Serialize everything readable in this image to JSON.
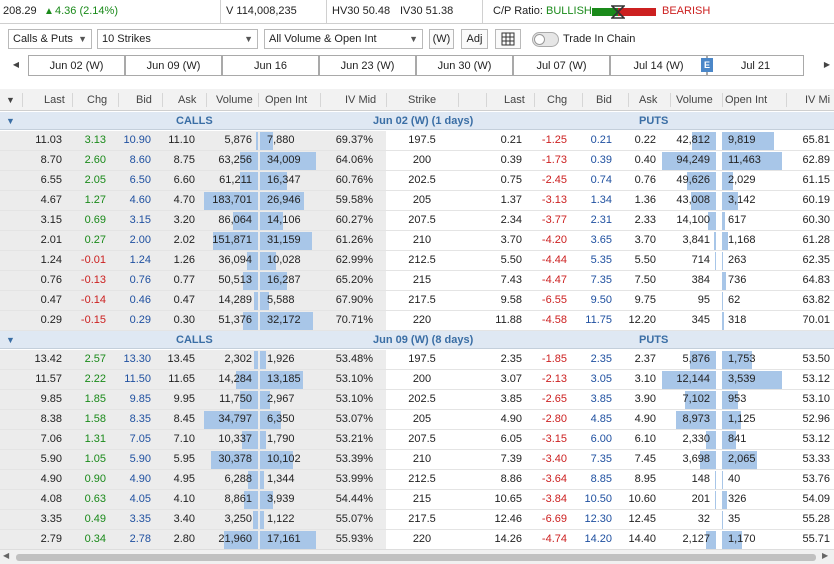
{
  "topbar": {
    "price": "208.29",
    "change": "4.36 (2.14%)",
    "volume": "V 114,008,235",
    "hv30": "HV30 50.48",
    "iv30": "IV30 51.38",
    "cp_ratio_label": "C/P Ratio:",
    "bullish": "BULLISH",
    "bearish": "BEARISH"
  },
  "controls": {
    "type_select": "Calls & Puts",
    "strikes_select": "10 Strikes",
    "volume_select": "All Volume & Open Int",
    "weekly_button": "(W)",
    "adj_button": "Adj",
    "trade_in_chain": "Trade In Chain"
  },
  "dates": [
    "Jun 02 (W)",
    "Jun 09 (W)",
    "Jun 16",
    "Jun 23 (W)",
    "Jun 30 (W)",
    "Jul 07 (W)",
    "Jul 14 (W)",
    "Jul 21"
  ],
  "earnings_marker": "E",
  "columns": {
    "call": [
      "Last",
      "Chg",
      "Bid",
      "Ask",
      "Volume",
      "Open Int",
      "IV Mid"
    ],
    "strike": "Strike",
    "put": [
      "Last",
      "Chg",
      "Bid",
      "Ask",
      "Volume",
      "Open Int",
      "IV Mi"
    ]
  },
  "sections": [
    {
      "calls_label": "CALLS",
      "expiry_label": "Jun 02 (W) (1 days)",
      "puts_label": "PUTS",
      "rows": [
        {
          "c": [
            "11.03",
            "3.13",
            "10.90",
            "11.10",
            "5,876",
            "7,880",
            "69.37%"
          ],
          "cvol": 0.03,
          "coi": 0.23,
          "strike": "197.5",
          "p": [
            "0.21",
            "-1.25",
            "0.21",
            "0.22",
            "42,812",
            "9,819",
            "65.81"
          ],
          "pvol": 0.45,
          "poi": 0.86
        },
        {
          "c": [
            "8.70",
            "2.60",
            "8.60",
            "8.75",
            "63,256",
            "34,009",
            "64.06%"
          ],
          "cvol": 0.34,
          "coi": 1.0,
          "strike": "200",
          "p": [
            "0.39",
            "-1.73",
            "0.39",
            "0.40",
            "94,249",
            "11,463",
            "62.89"
          ],
          "pvol": 1.0,
          "poi": 1.0
        },
        {
          "c": [
            "6.55",
            "2.05",
            "6.50",
            "6.60",
            "61,211",
            "16,347",
            "60.76%"
          ],
          "cvol": 0.33,
          "coi": 0.48,
          "strike": "202.5",
          "p": [
            "0.75",
            "-2.45",
            "0.74",
            "0.76",
            "49,626",
            "2,029",
            "61.15"
          ],
          "pvol": 0.53,
          "poi": 0.18
        },
        {
          "c": [
            "4.67",
            "1.27",
            "4.60",
            "4.70",
            "183,701",
            "26,946",
            "59.58%"
          ],
          "cvol": 1.0,
          "coi": 0.79,
          "strike": "205",
          "p": [
            "1.37",
            "-3.13",
            "1.34",
            "1.36",
            "43,008",
            "3,142",
            "60.19"
          ],
          "pvol": 0.46,
          "poi": 0.27
        },
        {
          "c": [
            "3.15",
            "0.69",
            "3.15",
            "3.20",
            "86,064",
            "14,106",
            "60.27%"
          ],
          "cvol": 0.47,
          "coi": 0.41,
          "strike": "207.5",
          "p": [
            "2.34",
            "-3.77",
            "2.31",
            "2.33",
            "14,100",
            "617",
            "60.30"
          ],
          "pvol": 0.15,
          "poi": 0.05
        },
        {
          "c": [
            "2.01",
            "0.27",
            "2.00",
            "2.02",
            "151,871",
            "31,159",
            "61.26%"
          ],
          "cvol": 0.83,
          "coi": 0.92,
          "strike": "210",
          "p": [
            "3.70",
            "-4.20",
            "3.65",
            "3.70",
            "3,841",
            "1,168",
            "61.28"
          ],
          "pvol": 0.04,
          "poi": 0.1
        },
        {
          "c": [
            "1.24",
            "-0.01",
            "1.24",
            "1.26",
            "36,094",
            "10,028",
            "62.99%"
          ],
          "cvol": 0.2,
          "coi": 0.29,
          "strike": "212.5",
          "p": [
            "5.50",
            "-4.44",
            "5.35",
            "5.50",
            "714",
            "263",
            "62.35"
          ],
          "pvol": 0.01,
          "poi": 0.02
        },
        {
          "c": [
            "0.76",
            "-0.13",
            "0.76",
            "0.77",
            "50,513",
            "16,287",
            "65.20%"
          ],
          "cvol": 0.27,
          "coi": 0.48,
          "strike": "215",
          "p": [
            "7.43",
            "-4.47",
            "7.35",
            "7.50",
            "384",
            "736",
            "64.83"
          ],
          "pvol": 0.0,
          "poi": 0.06
        },
        {
          "c": [
            "0.47",
            "-0.14",
            "0.46",
            "0.47",
            "14,289",
            "5,588",
            "67.90%"
          ],
          "cvol": 0.08,
          "coi": 0.16,
          "strike": "217.5",
          "p": [
            "9.58",
            "-6.55",
            "9.50",
            "9.75",
            "95",
            "62",
            "63.82"
          ],
          "pvol": 0.0,
          "poi": 0.01
        },
        {
          "c": [
            "0.29",
            "-0.15",
            "0.29",
            "0.30",
            "51,376",
            "32,172",
            "70.71%"
          ],
          "cvol": 0.28,
          "coi": 0.95,
          "strike": "220",
          "p": [
            "11.88",
            "-4.58",
            "11.75",
            "12.20",
            "345",
            "318",
            "70.01"
          ],
          "pvol": 0.0,
          "poi": 0.03
        }
      ]
    },
    {
      "calls_label": "CALLS",
      "expiry_label": "Jun 09 (W) (8 days)",
      "puts_label": "PUTS",
      "rows": [
        {
          "c": [
            "13.42",
            "2.57",
            "13.30",
            "13.45",
            "2,302",
            "1,926",
            "53.48%"
          ],
          "cvol": 0.07,
          "coi": 0.11,
          "strike": "197.5",
          "p": [
            "2.35",
            "-1.85",
            "2.35",
            "2.37",
            "5,876",
            "1,753",
            "53.50"
          ],
          "pvol": 0.48,
          "poi": 0.5
        },
        {
          "c": [
            "11.57",
            "2.22",
            "11.50",
            "11.65",
            "14,284",
            "13,185",
            "53.10%"
          ],
          "cvol": 0.41,
          "coi": 0.77,
          "strike": "200",
          "p": [
            "3.07",
            "-2.13",
            "3.05",
            "3.10",
            "12,144",
            "3,539",
            "53.12"
          ],
          "pvol": 1.0,
          "poi": 1.0
        },
        {
          "c": [
            "9.85",
            "1.85",
            "9.85",
            "9.95",
            "11,750",
            "2,967",
            "53.10%"
          ],
          "cvol": 0.34,
          "coi": 0.17,
          "strike": "202.5",
          "p": [
            "3.85",
            "-2.65",
            "3.85",
            "3.90",
            "7,102",
            "953",
            "53.10"
          ],
          "pvol": 0.58,
          "poi": 0.27
        },
        {
          "c": [
            "8.38",
            "1.58",
            "8.35",
            "8.45",
            "34,797",
            "6,350",
            "53.07%"
          ],
          "cvol": 1.0,
          "coi": 0.37,
          "strike": "205",
          "p": [
            "4.90",
            "-2.80",
            "4.85",
            "4.90",
            "8,973",
            "1,125",
            "52.96"
          ],
          "pvol": 0.74,
          "poi": 0.32
        },
        {
          "c": [
            "7.06",
            "1.31",
            "7.05",
            "7.10",
            "10,337",
            "1,790",
            "53.21%"
          ],
          "cvol": 0.3,
          "coi": 0.1,
          "strike": "207.5",
          "p": [
            "6.05",
            "-3.15",
            "6.00",
            "6.10",
            "2,330",
            "841",
            "53.12"
          ],
          "pvol": 0.19,
          "poi": 0.24
        },
        {
          "c": [
            "5.90",
            "1.05",
            "5.90",
            "5.95",
            "30,378",
            "10,102",
            "53.39%"
          ],
          "cvol": 0.87,
          "coi": 0.59,
          "strike": "210",
          "p": [
            "7.39",
            "-3.40",
            "7.35",
            "7.45",
            "3,698",
            "2,065",
            "53.33"
          ],
          "pvol": 0.3,
          "poi": 0.58
        },
        {
          "c": [
            "4.90",
            "0.90",
            "4.90",
            "4.95",
            "6,288",
            "1,344",
            "53.99%"
          ],
          "cvol": 0.18,
          "coi": 0.08,
          "strike": "212.5",
          "p": [
            "8.86",
            "-3.64",
            "8.85",
            "8.95",
            "148",
            "40",
            "53.76"
          ],
          "pvol": 0.01,
          "poi": 0.01
        },
        {
          "c": [
            "4.08",
            "0.63",
            "4.05",
            "4.10",
            "8,861",
            "3,939",
            "54.44%"
          ],
          "cvol": 0.25,
          "coi": 0.23,
          "strike": "215",
          "p": [
            "10.65",
            "-3.84",
            "10.50",
            "10.60",
            "201",
            "326",
            "54.09"
          ],
          "pvol": 0.02,
          "poi": 0.09
        },
        {
          "c": [
            "3.35",
            "0.49",
            "3.35",
            "3.40",
            "3,250",
            "1,122",
            "55.07%"
          ],
          "cvol": 0.09,
          "coi": 0.07,
          "strike": "217.5",
          "p": [
            "12.46",
            "-6.69",
            "12.30",
            "12.45",
            "32",
            "35",
            "55.28"
          ],
          "pvol": 0.0,
          "poi": 0.01
        },
        {
          "c": [
            "2.79",
            "0.34",
            "2.78",
            "2.80",
            "21,960",
            "17,161",
            "55.93%"
          ],
          "cvol": 0.63,
          "coi": 1.0,
          "strike": "220",
          "p": [
            "14.26",
            "-4.74",
            "14.20",
            "14.40",
            "2,127",
            "1,170",
            "55.71"
          ],
          "pvol": 0.18,
          "poi": 0.33
        }
      ]
    }
  ],
  "colors": {
    "positive": "#1a8a1a",
    "negative": "#cc2020",
    "bid": "#1f50a0",
    "volume_bar": "#a8c6e8",
    "section_bg": "#dfe8f3"
  },
  "icons": {
    "up_arrow": "up-arrow-icon",
    "grid_settings": "grid-settings-icon",
    "collapse": "collapse-triangle-icon",
    "scroll_left": "chevron-left-icon",
    "scroll_right": "chevron-right-icon"
  }
}
